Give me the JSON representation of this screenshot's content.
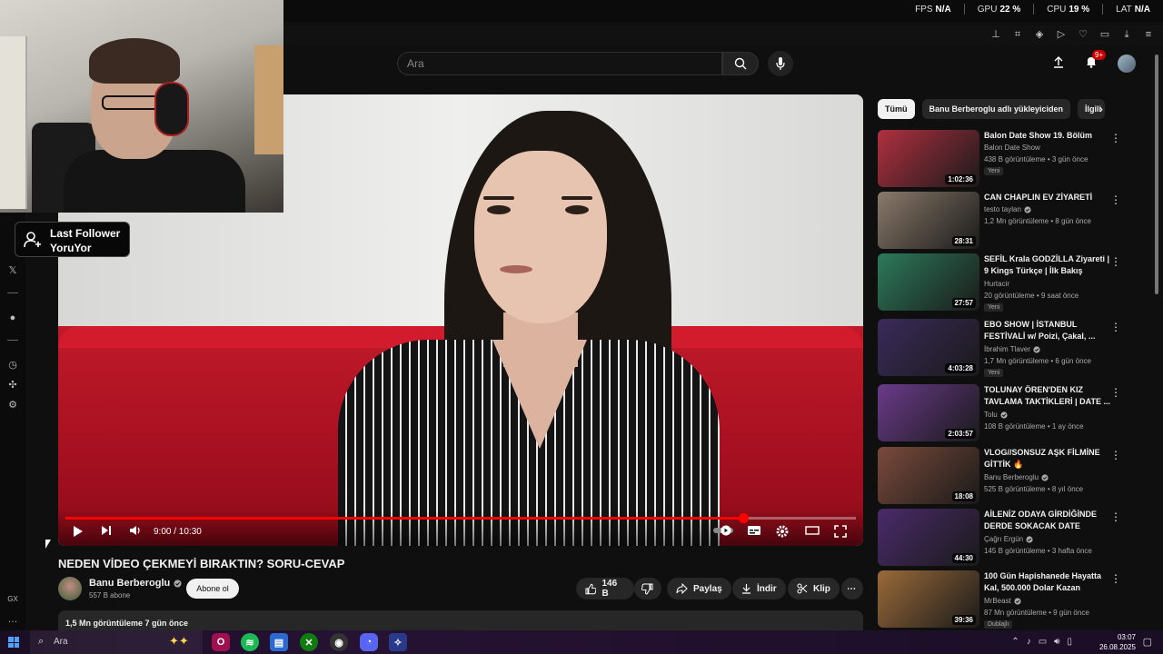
{
  "hud": {
    "fps_label": "FPS",
    "fps_value": "N/A",
    "gpu_label": "GPU",
    "gpu_value": "22 %",
    "cpu_label": "CPU",
    "cpu_value": "19 %",
    "lat_label": "LAT",
    "lat_value": "N/A"
  },
  "overlay": {
    "follower_title": "Last Follower",
    "follower_name": "YoruYor"
  },
  "header": {
    "search_placeholder": "Ara",
    "notification_count": "9+"
  },
  "player": {
    "time_display": "9:00 / 10:30",
    "progress": 0.857
  },
  "video": {
    "title": "NEDEN VİDEO ÇEKMEYİ BIRAKTIN? SORU-CEVAP",
    "channel": "Banu Berberoglu",
    "subscribers": "557 B abone",
    "subscribe_label": "Abone ol",
    "likes": "146 B",
    "share_label": "Paylaş",
    "download_label": "İndir",
    "clip_label": "Klip",
    "views_date": "1,5 Mn görüntüleme  7 gün önce"
  },
  "chips": [
    "Tümü",
    "Banu Berberoglu adlı yükleyiciden",
    "İlgili"
  ],
  "recommendations": [
    {
      "title": "Balon Date Show 19. Bölüm",
      "channel": "Balon Date Show",
      "verified": false,
      "meta": "438 B görüntüleme • 3 gün önce",
      "badge": "Yeni",
      "duration": "1:02:36",
      "thumb_color": "#b03040"
    },
    {
      "title": "CAN CHAPLIN EV ZİYARETİ",
      "channel": "testo taylan",
      "verified": true,
      "meta": "1,2 Mn görüntüleme • 8 gün önce",
      "badge": "",
      "duration": "28:31",
      "thumb_color": "#8a7a6a"
    },
    {
      "title": "SEFİL Krala GODZİLLA Ziyareti | 9 Kings Türkçe | İlk Bakış",
      "channel": "Hurtacir",
      "verified": false,
      "meta": "20 görüntüleme • 9 saat önce",
      "badge": "Yeni",
      "duration": "27:57",
      "thumb_color": "#2c7a5a"
    },
    {
      "title": "EBO SHOW | İSTANBUL FESTİVALİ w/ Poizi, Çakal, ...",
      "channel": "İbrahim Tlaver",
      "verified": true,
      "meta": "1,7 Mn görüntüleme • 6 gün önce",
      "badge": "Yeni",
      "duration": "4:03:28",
      "thumb_color": "#3a2a5a"
    },
    {
      "title": "TOLUNAY ÖREN'DEN KIZ TAVLAMA TAKTİKLERİ | DATE ...",
      "channel": "Tolu",
      "verified": true,
      "meta": "108 B görüntüleme • 1 ay önce",
      "badge": "",
      "duration": "2:03:57",
      "thumb_color": "#6a3a8a"
    },
    {
      "title": "VLOG//SONSUZ AŞK FİLMİNE GİTTİK 🔥",
      "channel": "Banu Berberoglu",
      "verified": true,
      "meta": "525 B görüntüleme • 8 yıl önce",
      "badge": "",
      "duration": "18:08",
      "thumb_color": "#7a4a3a"
    },
    {
      "title": "AİLENİZ ODAYA GİRDİĞİNDE DERDE SOKACAK DATE OYUN...",
      "channel": "Çağrı Ergün",
      "verified": true,
      "meta": "145 B görüntüleme • 3 hafta önce",
      "badge": "",
      "duration": "44:30",
      "thumb_color": "#4a2a6a"
    },
    {
      "title": "100 Gün Hapishanede Hayatta Kal, 500.000 Dolar Kazan",
      "channel": "MrBeast",
      "verified": true,
      "meta": "87 Mn görüntüleme • 9 gün önce",
      "badge": "Dublajlı",
      "duration": "39:36",
      "thumb_color": "#9a6a3a"
    }
  ],
  "taskbar": {
    "search_label": "Ara",
    "time": "03:07",
    "date": "26.08.2025"
  }
}
